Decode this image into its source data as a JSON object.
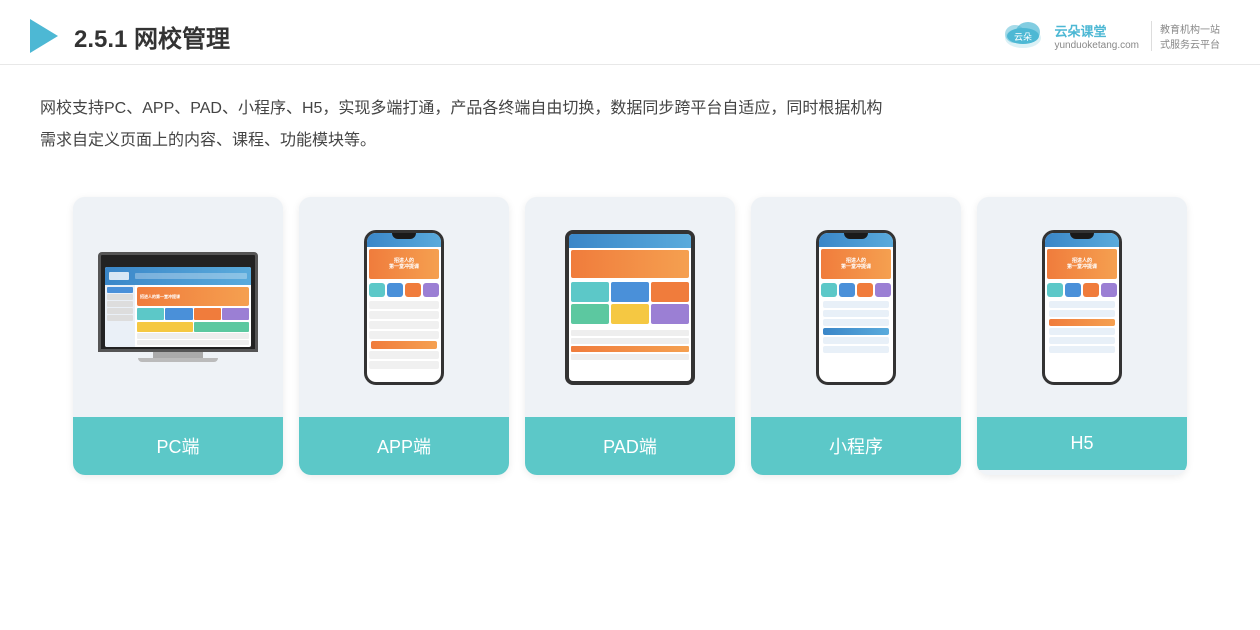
{
  "header": {
    "title_prefix": "2.5.1 ",
    "title_bold": "网校管理",
    "logo_url": "yunduoketang.com",
    "logo_name": "云朵课堂",
    "logo_slogan_line1": "教育机构一站",
    "logo_slogan_line2": "式服务云平台"
  },
  "description": {
    "line1": "网校支持PC、APP、PAD、小程序、H5，实现多端打通，产品各终端自由切换，数据同步跨平台自适应，同时根据机构",
    "line2": "需求自定义页面上的内容、课程、功能模块等。"
  },
  "cards": [
    {
      "id": "pc",
      "label": "PC端"
    },
    {
      "id": "app",
      "label": "APP端"
    },
    {
      "id": "pad",
      "label": "PAD端"
    },
    {
      "id": "mini",
      "label": "小程序"
    },
    {
      "id": "h5",
      "label": "H5"
    }
  ]
}
